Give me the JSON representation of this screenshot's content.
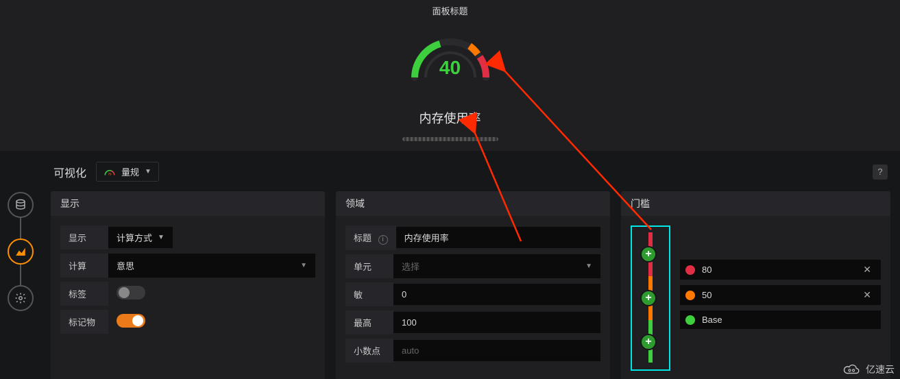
{
  "chart_data": {
    "type": "gauge",
    "title": "内存使用率",
    "panel_title": "面板标题",
    "value": 40,
    "min": 0,
    "max": 100,
    "unit": "",
    "thresholds": [
      {
        "color": "#3ecf3e",
        "from": 0,
        "to": 50,
        "label": "Base"
      },
      {
        "color": "#ff7800",
        "from": 50,
        "to": 80
      },
      {
        "color": "#e02f44",
        "from": 80,
        "to": 100
      }
    ]
  },
  "preview": {
    "panel_title": "面板标题",
    "gauge_value": "40",
    "gauge_label": "内存使用率"
  },
  "topbar": {
    "section_title": "可视化",
    "viz_type_label": "量规",
    "viz_icon_value": "79",
    "help_label": "?"
  },
  "display_card": {
    "header": "显示",
    "rows": {
      "show_label": "显示",
      "show_value": "计算方式",
      "calc_label": "计算",
      "calc_value": "意思",
      "tags_label": "标签",
      "markers_label": "标记物"
    },
    "tags_on": false,
    "markers_on": true
  },
  "field_card": {
    "header": "领域",
    "rows": {
      "title_label": "标题",
      "title_value": "内存使用率",
      "unit_label": "单元",
      "unit_placeholder": "选择",
      "min_label": "敏",
      "min_value": "0",
      "max_label": "最高",
      "max_value": "100",
      "decimals_label": "小数点",
      "decimals_placeholder": "auto"
    }
  },
  "thresholds_card": {
    "header": "门槛",
    "items": [
      {
        "color": "red",
        "value": "80",
        "removable": true
      },
      {
        "color": "orange",
        "value": "50",
        "removable": true
      },
      {
        "color": "green",
        "value": "Base",
        "removable": false
      }
    ]
  },
  "watermark": {
    "text": "亿速云"
  },
  "colors": {
    "green": "#3ecf3e",
    "orange": "#ff7800",
    "red": "#e02f44",
    "accent_cyan": "#00e5e5",
    "accent_amber": "#ff8f00"
  }
}
